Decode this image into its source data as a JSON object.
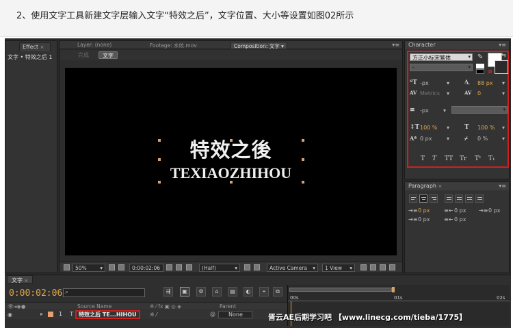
{
  "caption": "2、使用文字工具新建文字层输入文字“特效之后”，文字位置、大小等设置如图02所示",
  "effect_panel": {
    "tab": "Effect",
    "path": "文字 • 特效之后 1"
  },
  "viewer": {
    "tabs": {
      "layer": "Layer: (none)",
      "footage": "Footage: 水纹.mov",
      "composition": "Composition: 文字"
    },
    "crumbs": {
      "dim": "完成",
      "active": "文字"
    },
    "text_cn": "特效之後",
    "text_en": "TEXIAOZHIHOU",
    "footer": {
      "zoom": "50%",
      "timecode": "0:00:02:06",
      "resolution": "(Half)",
      "camera": "Active Camera",
      "view": "1 View"
    }
  },
  "character": {
    "title": "Character",
    "font": "方正小标宋繁体",
    "style": "-",
    "size": "-px",
    "leading": "88 px",
    "kerning": "Metrics",
    "tracking": "0",
    "stroke_width": "-px",
    "vscale": "100 %",
    "hscale": "100 %",
    "baseline": "0 px",
    "tsume": "0 %",
    "type_buttons": [
      "T",
      "T",
      "TT",
      "Tr",
      "T¹",
      "T₁"
    ]
  },
  "paragraph": {
    "title": "Paragraph",
    "indent_left": "0 px",
    "indent_first": "0 px",
    "indent_right": "0 px",
    "space_before": "0 px",
    "space_after": "0 px"
  },
  "timeline": {
    "tab": "文字",
    "time": "0:00:02:06",
    "ruler": [
      "00s",
      "01s",
      "02s"
    ],
    "col_source": "Source Name",
    "col_parent": "Parent",
    "layer_index": "1",
    "layer_name": "特效之后 TE...HIHOU",
    "layer_parent": "None"
  },
  "watermark": "晋云AE后期学习吧 【www.linecg.com/tieba/1775】",
  "colors": {
    "accent_orange": "#e3a84a",
    "highlight_red": "#d0201e",
    "canvas": "#000000"
  }
}
